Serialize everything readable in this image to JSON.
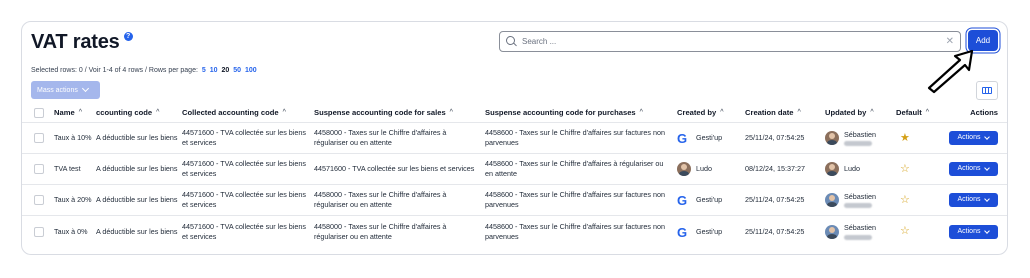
{
  "header": {
    "title": "VAT rates",
    "help_icon": "question-icon"
  },
  "search": {
    "placeholder": "Search ...",
    "value": ""
  },
  "toolbar": {
    "add_label": "Add",
    "mass_actions_label": "Mass actions"
  },
  "pagination": {
    "summary": "Selected rows: 0 /  Voir 1-4 of 4 rows /  Rows per page:",
    "page_sizes": [
      "5",
      "10",
      "20",
      "50",
      "100"
    ],
    "current_page_size": "20"
  },
  "columns": [
    "Name",
    "ccounting code",
    "Collected accounting code",
    "Suspense accounting code for sales",
    "Suspense accounting code for purchases",
    "Created by",
    "Creation date",
    "Updated by",
    "Default",
    "Actions"
  ],
  "rows": [
    {
      "name": "Taux à 10%",
      "deductible": "A déductible sur les biens et services",
      "collected": "44571600 - TVA collectée sur les biens et services",
      "suspense_sales": "4458000 - Taxes sur le Chiffre d'affaires à régulariser ou en attente",
      "suspense_purchases": "4458600 - Taxes sur le Chiffre d'affaires sur factures non parvenues",
      "created_by": "Gesti'up",
      "creation_date": "25/11/24, 07:54:25",
      "updated_by": "Sébastien",
      "default": true,
      "actions_label": "Actions"
    },
    {
      "name": "TVA test",
      "deductible": "A déductible sur les biens et services",
      "collected": "44571600 - TVA collectée sur les biens et services",
      "suspense_sales": "44571600 - TVA collectée sur les biens et services",
      "suspense_purchases": "4458600 - Taxes sur le Chiffre d'affaires à régulariser ou en attente",
      "created_by": "Ludo",
      "creation_date": "08/12/24, 15:37:27",
      "updated_by": "Ludo",
      "default": false,
      "actions_label": "Actions"
    },
    {
      "name": "Taux à 20%",
      "deductible": "A déductible sur les biens et services",
      "collected": "44571600 - TVA collectée sur les biens et services",
      "suspense_sales": "4458000 - Taxes sur le Chiffre d'affaires à régulariser ou en attente",
      "suspense_purchases": "4458600 - Taxes sur le Chiffre d'affaires sur factures non parvenues",
      "created_by": "Gesti'up",
      "creation_date": "25/11/24, 07:54:25",
      "updated_by": "Sébastien",
      "default": false,
      "actions_label": "Actions"
    },
    {
      "name": "Taux à 0%",
      "deductible": "A déductible sur les biens et services",
      "collected": "44571600 - TVA collectée sur les biens et services",
      "suspense_sales": "4458000 - Taxes sur le Chiffre d'affaires à régulariser ou en attente",
      "suspense_purchases": "4458600 - Taxes sur le Chiffre d'affaires sur factures non parvenues",
      "created_by": "Gesti'up",
      "creation_date": "25/11/24, 07:54:25",
      "updated_by": "Sébastien",
      "default": false,
      "actions_label": "Actions"
    }
  ],
  "colors": {
    "accent": "#1d4ed8",
    "mass_actions_disabled": "#a5b7ec",
    "star": "#d4a017"
  }
}
